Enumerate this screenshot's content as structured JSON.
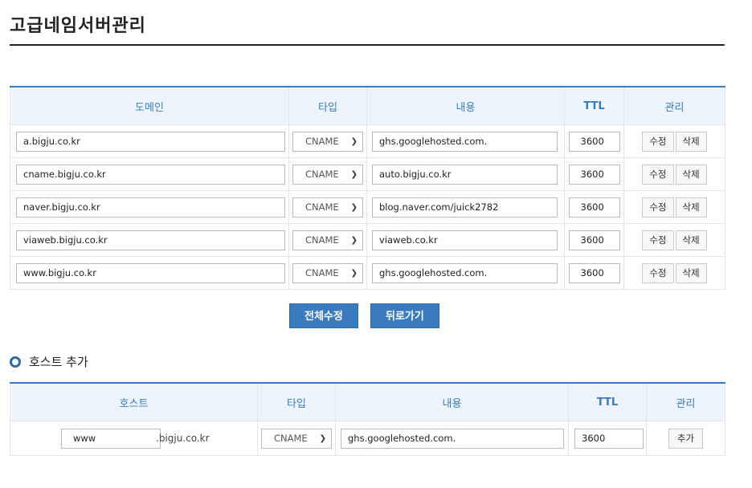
{
  "page_title": "고급네임서버관리",
  "host_table": {
    "headers": {
      "domain": "도메인",
      "type": "타입",
      "content": "내용",
      "ttl": "TTL",
      "manage": "관리"
    },
    "rows": [
      {
        "domain": "a.bigju.co.kr",
        "type": "CNAME",
        "content": "ghs.googlehosted.com.",
        "ttl": "3600"
      },
      {
        "domain": "cname.bigju.co.kr",
        "type": "CNAME",
        "content": "auto.bigju.co.kr",
        "ttl": "3600"
      },
      {
        "domain": "naver.bigju.co.kr",
        "type": "CNAME",
        "content": "blog.naver.com/juick2782",
        "ttl": "3600"
      },
      {
        "domain": "viaweb.bigju.co.kr",
        "type": "CNAME",
        "content": "viaweb.co.kr",
        "ttl": "3600"
      },
      {
        "domain": "www.bigju.co.kr",
        "type": "CNAME",
        "content": "ghs.googlehosted.com.",
        "ttl": "3600"
      }
    ],
    "edit_label": "수정",
    "delete_label": "삭제"
  },
  "actions": {
    "edit_all": "전체수정",
    "back": "뒤로가기"
  },
  "add_section": {
    "title": "호스트 추가",
    "headers": {
      "host": "호스트",
      "type": "타입",
      "content": "내용",
      "ttl": "TTL",
      "manage": "관리"
    },
    "host_value": "www",
    "domain_suffix": ".bigju.co.kr",
    "type_value": "CNAME",
    "content_value": "ghs.googlehosted.com.",
    "ttl_value": "3600",
    "add_label": "추가"
  },
  "colors": {
    "accent": "#3a7bbf",
    "header_bg": "#eef4fb"
  }
}
